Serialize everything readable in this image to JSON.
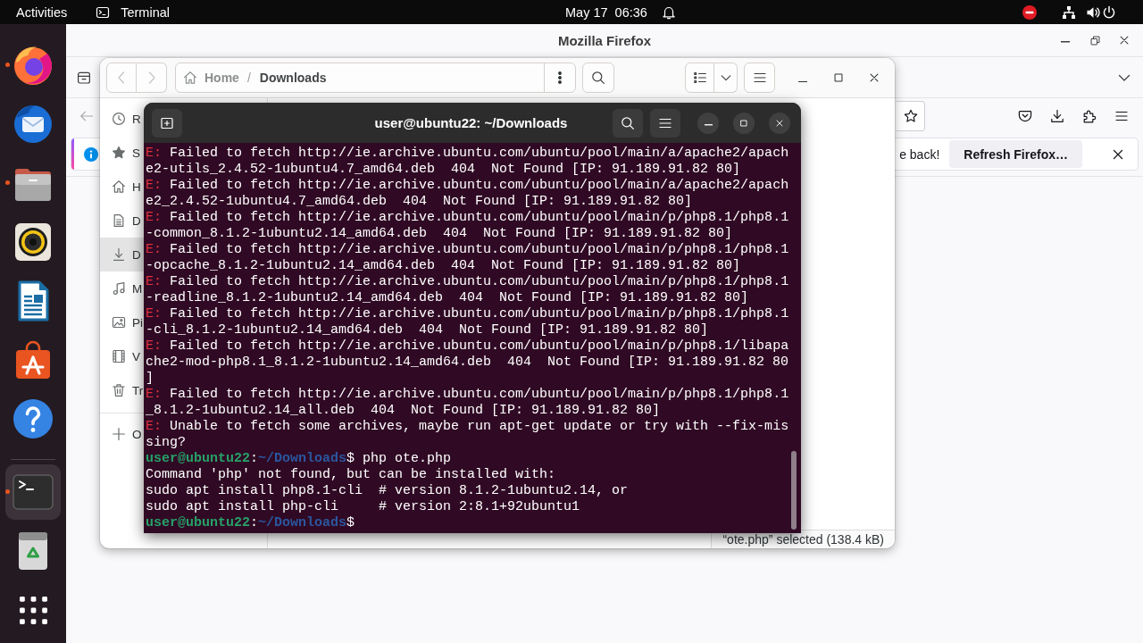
{
  "top_bar": {
    "activities": "Activities",
    "app_menu": "Terminal",
    "clock": "May 17  06:36",
    "do_not_disturb": true
  },
  "dock": {
    "favorites": [
      {
        "kind": "browser",
        "running": true,
        "selected": false
      },
      {
        "kind": "mail",
        "running": false,
        "selected": false
      },
      {
        "kind": "files",
        "running": true,
        "selected": false
      },
      {
        "kind": "music",
        "running": false,
        "selected": false
      },
      {
        "kind": "writer",
        "running": false,
        "selected": false
      },
      {
        "kind": "store",
        "running": false,
        "selected": false
      },
      {
        "kind": "help",
        "running": false,
        "selected": false
      }
    ],
    "open_apps": [
      {
        "kind": "terminal",
        "running": true,
        "selected": true
      }
    ],
    "utilities": [
      {
        "kind": "trash",
        "selected": false
      },
      {
        "kind": "apps",
        "selected": false
      }
    ]
  },
  "firefox_window": {
    "title": "Mozilla Firefox",
    "back_button": {
      "disabled": true
    },
    "notification": {
      "message": "e back!",
      "action": "Refresh Firefox…"
    }
  },
  "files_window": {
    "nav_buttons": [
      {
        "kind": "back",
        "disabled": true
      },
      {
        "kind": "forward",
        "disabled": true
      }
    ],
    "path": {
      "crumbs": [
        {
          "kind": "home",
          "label": "Home",
          "selected": false
        },
        {
          "kind": "folder",
          "label": "Downloads",
          "selected": true
        }
      ],
      "separator": "/"
    },
    "sidebar": {
      "places": [
        {
          "kind": "recent",
          "label": "R",
          "selected": false
        },
        {
          "kind": "starred",
          "label": "S",
          "selected": false
        },
        {
          "kind": "home",
          "label": "H",
          "selected": false
        },
        {
          "kind": "documents",
          "label": "D",
          "selected": false
        },
        {
          "kind": "downloads",
          "label": "D",
          "selected": true
        },
        {
          "kind": "music",
          "label": "M",
          "selected": false
        },
        {
          "kind": "pictures",
          "label": "Pi",
          "selected": false
        },
        {
          "kind": "videos",
          "label": "V",
          "selected": false
        },
        {
          "kind": "trash",
          "label": "Tr",
          "selected": false
        }
      ],
      "other_locations": {
        "label": "O"
      }
    },
    "status": "“ote.php” selected (138.4 kB)"
  },
  "terminal_window": {
    "title": "user@ubuntu22: ~/Downloads",
    "lines": [
      {
        "kind": "error",
        "prefix": "E:",
        "text": "Failed to fetch http://ie.archive.ubuntu.com/ubuntu/pool/main/a/apache2/apache2-utils_2.4.52-1ubuntu4.7_amd64.deb  404  Not Found [IP: 91.189.91.82 80]"
      },
      {
        "kind": "error",
        "prefix": "E:",
        "text": "Failed to fetch http://ie.archive.ubuntu.com/ubuntu/pool/main/a/apache2/apache2_2.4.52-1ubuntu4.7_amd64.deb  404  Not Found [IP: 91.189.91.82 80]"
      },
      {
        "kind": "error",
        "prefix": "E:",
        "text": "Failed to fetch http://ie.archive.ubuntu.com/ubuntu/pool/main/p/php8.1/php8.1-common_8.1.2-1ubuntu2.14_amd64.deb  404  Not Found [IP: 91.189.91.82 80]"
      },
      {
        "kind": "error",
        "prefix": "E:",
        "text": "Failed to fetch http://ie.archive.ubuntu.com/ubuntu/pool/main/p/php8.1/php8.1-opcache_8.1.2-1ubuntu2.14_amd64.deb  404  Not Found [IP: 91.189.91.82 80]"
      },
      {
        "kind": "error",
        "prefix": "E:",
        "text": "Failed to fetch http://ie.archive.ubuntu.com/ubuntu/pool/main/p/php8.1/php8.1-readline_8.1.2-1ubuntu2.14_amd64.deb  404  Not Found [IP: 91.189.91.82 80]"
      },
      {
        "kind": "error",
        "prefix": "E:",
        "text": "Failed to fetch http://ie.archive.ubuntu.com/ubuntu/pool/main/p/php8.1/php8.1-cli_8.1.2-1ubuntu2.14_amd64.deb  404  Not Found [IP: 91.189.91.82 80]"
      },
      {
        "kind": "error",
        "prefix": "E:",
        "text": "Failed to fetch http://ie.archive.ubuntu.com/ubuntu/pool/main/p/php8.1/libapache2-mod-php8.1_8.1.2-1ubuntu2.14_amd64.deb  404  Not Found [IP: 91.189.91.82 80]"
      },
      {
        "kind": "error",
        "prefix": "E:",
        "text": "Failed to fetch http://ie.archive.ubuntu.com/ubuntu/pool/main/p/php8.1/php8.1_8.1.2-1ubuntu2.14_all.deb  404  Not Found [IP: 91.189.91.82 80]"
      },
      {
        "kind": "error",
        "prefix": "E:",
        "text": "Unable to fetch some archives, maybe run apt-get update or try with --fix-missing?"
      },
      {
        "kind": "prompt",
        "user": "user@ubuntu22",
        "separator": ":",
        "path": "~/Downloads",
        "symbol": "$",
        "command": "php ote.php"
      },
      {
        "kind": "output",
        "text": "Command 'php' not found, but can be installed with:"
      },
      {
        "kind": "output",
        "text": "sudo apt install php8.1-cli  # version 8.1.2-1ubuntu2.14, or"
      },
      {
        "kind": "output",
        "text": "sudo apt install php-cli     # version 2:8.1+92ubuntu1"
      },
      {
        "kind": "prompt",
        "user": "user@ubuntu22",
        "separator": ":",
        "path": "~/Downloads",
        "symbol": "$"
      }
    ]
  }
}
